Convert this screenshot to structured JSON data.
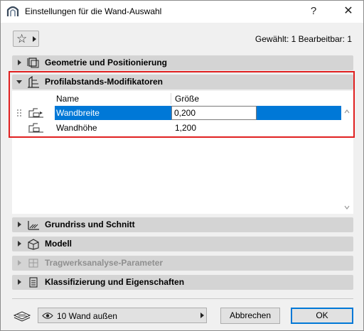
{
  "window": {
    "title": "Einstellungen für die Wand-Auswahl",
    "help_label": "?",
    "close_label": "✕"
  },
  "toolbar": {
    "favorites_icon": "star-icon",
    "selection_info": "Gewählt: 1 Bearbeitbar: 1"
  },
  "panels": [
    {
      "label": "Geometrie und Positionierung",
      "icon": "geometry-icon",
      "expanded": false,
      "enabled": true
    },
    {
      "label": "Profilabstands-Modifikatoren",
      "icon": "profile-modifier-icon",
      "expanded": true,
      "enabled": true
    },
    {
      "label": "Grundriss und Schnitt",
      "icon": "floorplan-section-icon",
      "expanded": false,
      "enabled": true
    },
    {
      "label": "Modell",
      "icon": "model-icon",
      "expanded": false,
      "enabled": true
    },
    {
      "label": "Tragwerksanalyse-Parameter",
      "icon": "structural-analysis-icon",
      "expanded": false,
      "enabled": false
    },
    {
      "label": "Klassifizierung und Eigenschaften",
      "icon": "classification-icon",
      "expanded": false,
      "enabled": true
    }
  ],
  "modifier_table": {
    "columns": [
      "Name",
      "Größe"
    ],
    "rows": [
      {
        "name": "Wandbreite",
        "value": "0,200",
        "selected": true
      },
      {
        "name": "Wandhöhe",
        "value": "1,200",
        "selected": false
      }
    ]
  },
  "footer": {
    "layer_label": "10 Wand außen",
    "cancel_label": "Abbrechen",
    "ok_label": "OK"
  },
  "colors": {
    "selection": "#0078d7",
    "highlight_frame": "#e02020",
    "panel_header": "#d4d4d4"
  }
}
